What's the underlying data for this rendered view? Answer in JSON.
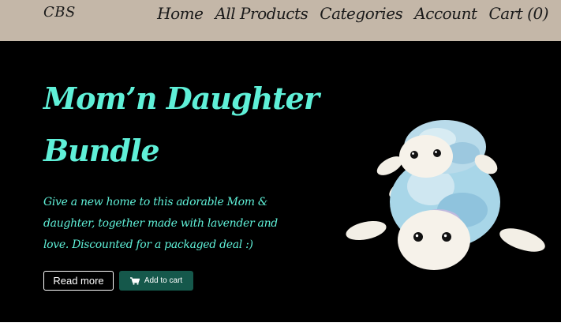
{
  "header": {
    "brand": "CBS",
    "nav": [
      {
        "label": "Home"
      },
      {
        "label": "All Products"
      },
      {
        "label": "Categories"
      },
      {
        "label": "Account"
      },
      {
        "label": "Cart (0)"
      }
    ]
  },
  "hero": {
    "title": "Mom’n Daughter Bundle",
    "description": "Give a new home to this adorable Mom & daughter, together made with lavender and love. Discounted for a packaged deal :)",
    "read_more_label": "Read more",
    "add_to_cart_label": "Add to cart",
    "image": {
      "icon": "crochet-turtles-image"
    }
  },
  "colors": {
    "nav_bg": "#c4b7a8",
    "hero_bg": "#000000",
    "accent_text": "#5ff0d8",
    "cart_button": "#15584b"
  }
}
